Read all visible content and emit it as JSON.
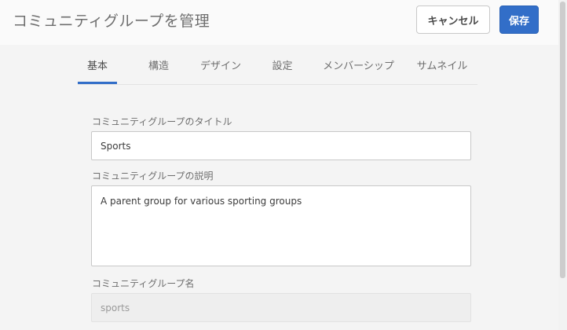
{
  "header": {
    "title": "コミュニティグループを管理",
    "cancel_label": "キャンセル",
    "save_label": "保存"
  },
  "tabs": [
    {
      "label": "基本",
      "active": true
    },
    {
      "label": "構造",
      "active": false
    },
    {
      "label": "デザイン",
      "active": false
    },
    {
      "label": "設定",
      "active": false
    },
    {
      "label": "メンバーシップ",
      "active": false
    },
    {
      "label": "サムネイル",
      "active": false
    }
  ],
  "form": {
    "title_label": "コミュニティグループのタイトル",
    "title_value": "Sports",
    "description_label": "コミュニティグループの説明",
    "description_value": "A parent group for various sporting groups",
    "name_label": "コミュニティグループ名",
    "name_value": "sports"
  },
  "colors": {
    "accent": "#326ec8",
    "background": "#f4f4f4",
    "header": "#fafafa"
  }
}
